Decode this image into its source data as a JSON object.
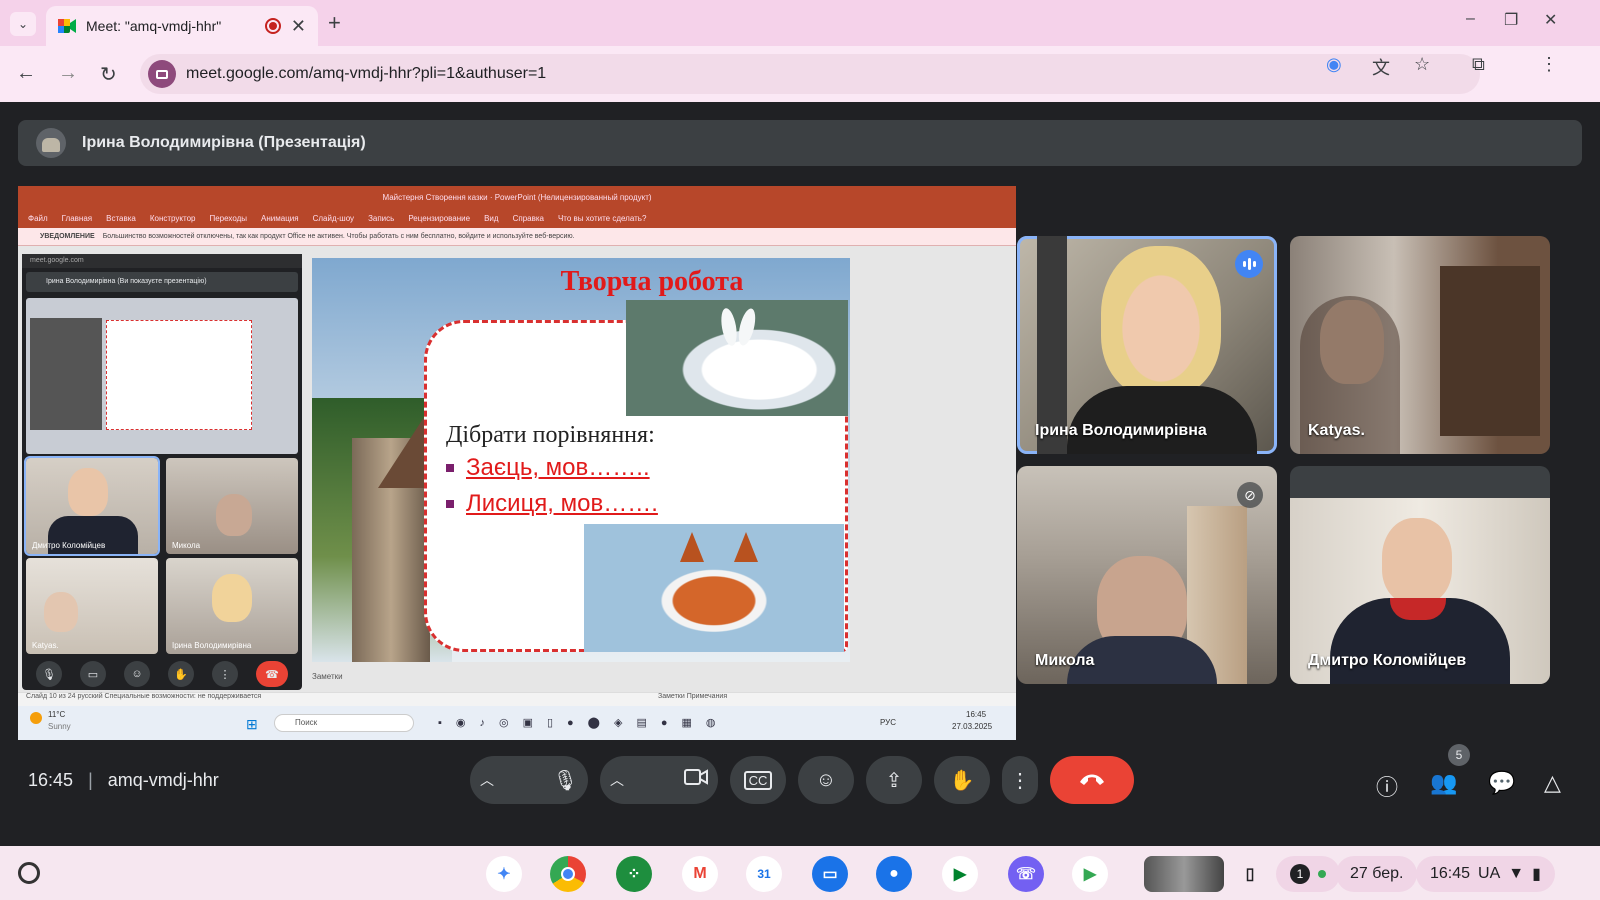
{
  "browser": {
    "tab_title": "Meet: \"amq-vmdj-hhr\"",
    "tab_close": "✕",
    "new_tab": "+",
    "url": "meet.google.com/amq-vmdj-hhr?pli=1&authuser=1"
  },
  "meet": {
    "presenter_banner": "Ірина Володимирівна (Презентація)",
    "time": "16:45",
    "separator": "|",
    "meeting_code": "amq-vmdj-hhr",
    "participants_count": "5"
  },
  "shared_screen": {
    "slide": {
      "title": "Творча робота",
      "heading": "Дібрати порівняння:",
      "bullets": [
        "Заєць, мов……..",
        "Лисиця, мов……."
      ]
    },
    "powerpoint": {
      "window_title": "Майстерня Створення казки  ·  PowerPoint (Нелицензированный продукт)",
      "menu": [
        "Файл",
        "Главная",
        "Вставка",
        "Конструктор",
        "Переходы",
        "Анимация",
        "Слайд-шоу",
        "Запись",
        "Рецензирование",
        "Вид",
        "Справка",
        "Что вы хотите сделать?"
      ],
      "warning_label": "УВЕДОМЛЕНИЕ",
      "warning_text": "Большинство возможностей отключены, так как продукт Office не активен. Чтобы работать с ним бесплатно, войдите и используйте веб-версию.",
      "notes_label": "Заметки",
      "status_left": "Слайд 10 из 24    русский    Специальные возможности: не поддерживается",
      "status_right": "Заметки   Примечания"
    },
    "windows_taskbar": {
      "weather_temp": "11°C",
      "weather_desc": "Sunny",
      "search_placeholder": "Поиск",
      "lang": "РУС",
      "time": "16:45",
      "date": "27.03.2025"
    },
    "mini_meet": {
      "tab_url": "meet.google.com",
      "presenting_banner": "Ірина Володимирівна (Ви показуєте презентацію)",
      "tiles": [
        "Дмитро Коломійцев",
        "Микола",
        "Katyas.",
        "Ірина Володимирівна"
      ]
    }
  },
  "participants": [
    {
      "name": "Ірина Володимирівна",
      "speaking": true
    },
    {
      "name": "Katyas.",
      "speaking": false
    },
    {
      "name": "Микола",
      "muted": true
    },
    {
      "name": "Дмитро Коломійцев",
      "speaking": false
    }
  ],
  "shelf": {
    "date": "27 бер.",
    "time": "16:45",
    "locale": "UA",
    "notifications": "1"
  },
  "colors": {
    "meet_bg": "#202124",
    "end_call": "#ea4335",
    "active_outline": "#8ab4f8",
    "slide_title": "#e11a1a"
  }
}
